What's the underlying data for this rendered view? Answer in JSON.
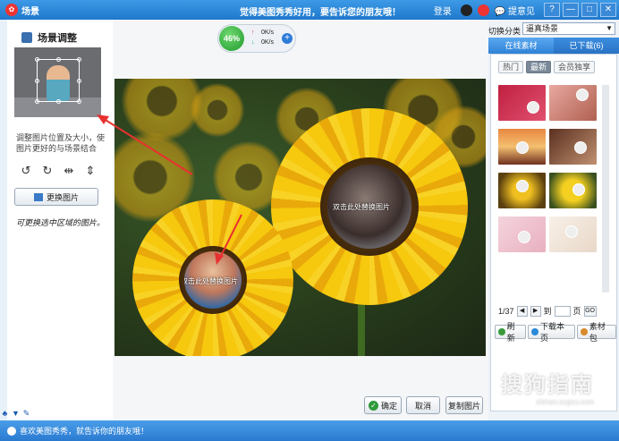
{
  "titlebar": {
    "title": "场景",
    "message": "觉得美图秀秀好用，要告诉您的朋友哦！",
    "login": "登录",
    "help": "提意见",
    "controls": [
      "?",
      "—",
      "□",
      "✕"
    ]
  },
  "left": {
    "heading": "场景调整",
    "description": "调整图片位置及大小，使图片更好的与场景结合",
    "tools": [
      "↺",
      "↻",
      "⇹",
      "⇕"
    ],
    "replace_button": "更换图片",
    "note": "可更换选中区域的图片。"
  },
  "speed": {
    "percent": "46%",
    "up": "0K/s",
    "down": "0K/s"
  },
  "canvas": {
    "hole_label_large": "双击此处替换图片",
    "hole_label_small": "双击此处替换图片"
  },
  "bottom_buttons": {
    "ok": "确定",
    "cancel": "取消",
    "reset": "复制图片"
  },
  "right": {
    "switch_label": "切换分类",
    "switch_value": "逼真场景",
    "tabs": [
      "在线素材",
      "已下载(6)"
    ],
    "subtabs": [
      "热门",
      "最新",
      "会员独享"
    ],
    "page_info": "1/37",
    "goto_prefix": "到",
    "goto_suffix": "页",
    "go": "GO",
    "actions": [
      "刷新",
      "下载本页",
      "素材包"
    ]
  },
  "watermark": {
    "text": "搜狗指南",
    "url": "zhinan.sogou.com"
  },
  "status": {
    "text": "喜欢美图秀秀，就告诉你的朋友哦！"
  }
}
